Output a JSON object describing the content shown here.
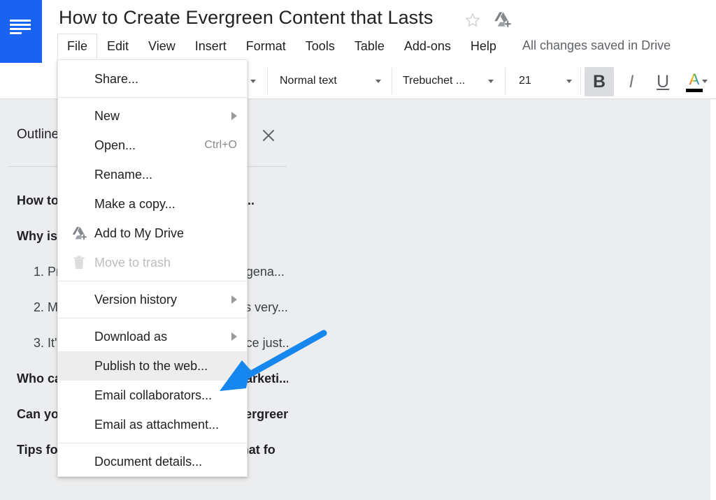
{
  "app": {
    "name": "Google Docs",
    "logo_icon": "docs-logo-icon",
    "accent_blue": "#1a62f2",
    "annotation_blue": "#1787f0"
  },
  "header": {
    "doc_title": "How to Create Evergreen Content that Lasts",
    "star_icon": "star-outline-icon",
    "drive_icon": "add-to-drive-icon",
    "save_status": "All changes saved in Drive",
    "menus": [
      {
        "label": "File",
        "active": true
      },
      {
        "label": "Edit",
        "active": false
      },
      {
        "label": "View",
        "active": false
      },
      {
        "label": "Insert",
        "active": false
      },
      {
        "label": "Format",
        "active": false
      },
      {
        "label": "Tools",
        "active": false
      },
      {
        "label": "Table",
        "active": false
      },
      {
        "label": "Add-ons",
        "active": false
      },
      {
        "label": "Help",
        "active": false
      }
    ]
  },
  "toolbar": {
    "paragraph_style": "Normal text",
    "font_family": "Trebuchet ...",
    "font_size": "21",
    "bold_label": "B",
    "italic_label": "I",
    "underline_label": "U",
    "text_color_label": "A",
    "bold_active": true,
    "caret_icon": "chevron-down-icon"
  },
  "outline": {
    "title": "Outline",
    "close_icon": "close-icon",
    "items": [
      {
        "text": "How to Create Evergreen Content that...",
        "level": 0
      },
      {
        "text": "Why is Evergreen Content Important?",
        "level": 0
      },
      {
        "text": "1. Provides consistent traffic and lead gena...",
        "level": 1
      },
      {
        "text": "2. Makes content creation process less very...",
        "level": 1
      },
      {
        "text": "3. It's a great resource for your audience just...",
        "level": 1
      },
      {
        "text": "Who cares about evergreen content marketi...",
        "level": 0
      },
      {
        "text": "Can you make any piece of content evergreen s...",
        "level": 0
      },
      {
        "text": "Tips for Creating Evergreen Content that fo",
        "level": 0
      }
    ]
  },
  "file_menu": {
    "groups": [
      {
        "rows": [
          {
            "label": "Share...",
            "icon": null,
            "accel": null,
            "submenu": false,
            "disabled": false,
            "highlight": false
          }
        ]
      },
      {
        "rows": [
          {
            "label": "New",
            "icon": null,
            "accel": null,
            "submenu": true,
            "disabled": false,
            "highlight": false
          },
          {
            "label": "Open...",
            "icon": null,
            "accel": "Ctrl+O",
            "submenu": false,
            "disabled": false,
            "highlight": false
          },
          {
            "label": "Rename...",
            "icon": null,
            "accel": null,
            "submenu": false,
            "disabled": false,
            "highlight": false
          },
          {
            "label": "Make a copy...",
            "icon": null,
            "accel": null,
            "submenu": false,
            "disabled": false,
            "highlight": false
          },
          {
            "label": "Add to My Drive",
            "icon": "add-to-drive-icon",
            "accel": null,
            "submenu": false,
            "disabled": false,
            "highlight": false
          },
          {
            "label": "Move to trash",
            "icon": "trash-icon",
            "accel": null,
            "submenu": false,
            "disabled": true,
            "highlight": false
          }
        ]
      },
      {
        "rows": [
          {
            "label": "Version history",
            "icon": null,
            "accel": null,
            "submenu": true,
            "disabled": false,
            "highlight": false
          }
        ]
      },
      {
        "rows": [
          {
            "label": "Download as",
            "icon": null,
            "accel": null,
            "submenu": true,
            "disabled": false,
            "highlight": false
          },
          {
            "label": "Publish to the web...",
            "icon": null,
            "accel": null,
            "submenu": false,
            "disabled": false,
            "highlight": true
          },
          {
            "label": "Email collaborators...",
            "icon": null,
            "accel": null,
            "submenu": false,
            "disabled": false,
            "highlight": false
          },
          {
            "label": "Email as attachment...",
            "icon": null,
            "accel": null,
            "submenu": false,
            "disabled": false,
            "highlight": false
          }
        ]
      },
      {
        "rows": [
          {
            "label": "Document details...",
            "icon": null,
            "accel": null,
            "submenu": false,
            "disabled": false,
            "highlight": false
          }
        ]
      }
    ]
  },
  "annotation": {
    "type": "arrow",
    "points_to": "Publish to the web...",
    "color": "#1787f0"
  }
}
